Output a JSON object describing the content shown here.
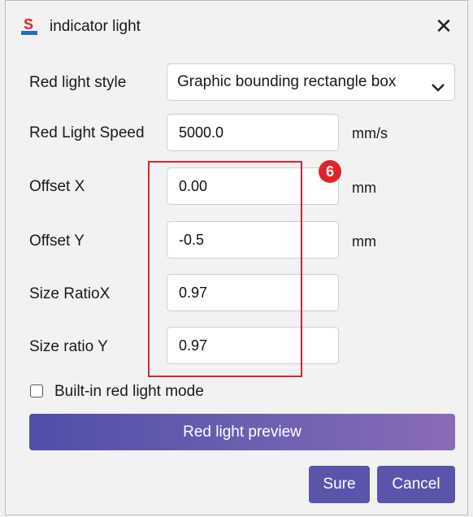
{
  "window": {
    "title": "indicator light",
    "icon": "app-logo-icon",
    "close_icon": "close-icon"
  },
  "red_light_style": {
    "label": "Red light style",
    "selected": "Graphic bounding rectangle box",
    "chevron_icon": "chevron-down-icon"
  },
  "red_light_speed": {
    "label": "Red Light Speed",
    "value": "5000.0",
    "unit": "mm/s"
  },
  "offset_x": {
    "label": "Offset X",
    "value": "0.00",
    "unit": "mm"
  },
  "offset_y": {
    "label": "Offset Y",
    "value": "-0.5",
    "unit": "mm"
  },
  "size_ratio_x": {
    "label": "Size RatioX",
    "value": "0.97"
  },
  "size_ratio_y": {
    "label": "Size ratio Y",
    "value": "0.97"
  },
  "annotation": {
    "badge": "6",
    "color": "#e0232a"
  },
  "builtin_mode": {
    "label": "Built-in red light mode",
    "checked": false
  },
  "buttons": {
    "preview": "Red light preview",
    "sure": "Sure",
    "cancel": "Cancel"
  },
  "colors": {
    "button": "#5a54ad",
    "gradient_start": "#4f4fa8",
    "gradient_end": "#8a6bb8",
    "highlight": "#e0232a"
  }
}
